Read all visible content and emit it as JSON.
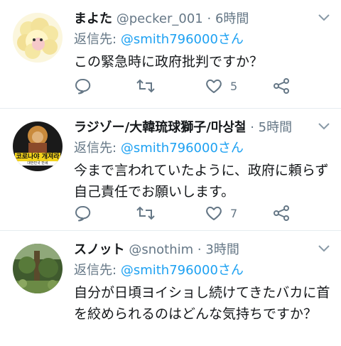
{
  "tweets": [
    {
      "name": "まよた",
      "handle": "@pecker_001",
      "time": "6時間",
      "reply_prefix": "返信先:",
      "reply_to": "@smith796000さん",
      "text": "この緊急時に政府批判ですか？",
      "like_count": "5"
    },
    {
      "name": "ラジゾー/大韓琉球獅子/마상철",
      "handle": "",
      "time": "5時間",
      "reply_prefix": "返信先:",
      "reply_to": "@smith796000さん",
      "text": "今まで言われていたように、政府に頼らず自己責任でお願いします。",
      "like_count": "7"
    },
    {
      "name": "スノット",
      "handle": "@snothim",
      "time": "3時間",
      "reply_prefix": "返信先:",
      "reply_to": "@smith796000さん",
      "text": "自分が日頃ヨイショし続けてきたバカに首を絞められるのはどんな気持ちですか？",
      "like_count": ""
    }
  ],
  "separator": "·",
  "avatar2_text": "코로나야 개져라",
  "avatar2_subtext": "대한민국 만세",
  "colors": {
    "accent": "#1da1f2",
    "secondary": "#657786",
    "border": "#e6ecf0"
  },
  "icons": [
    "reply-icon",
    "retweet-icon",
    "like-icon",
    "share-icon",
    "caret-down-icon"
  ]
}
